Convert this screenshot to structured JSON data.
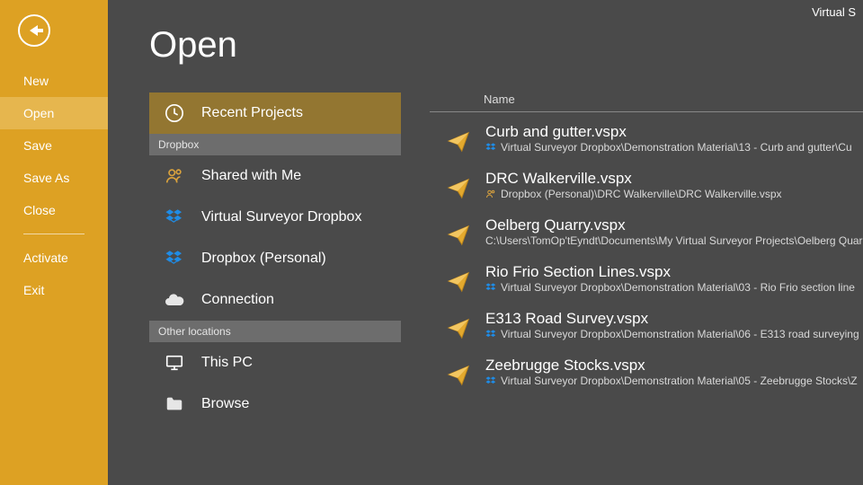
{
  "titlebar": "Virtual S",
  "sidebar": {
    "items": [
      {
        "label": "New",
        "selected": false
      },
      {
        "label": "Open",
        "selected": true
      },
      {
        "label": "Save",
        "selected": false
      },
      {
        "label": "Save As",
        "selected": false
      },
      {
        "label": "Close",
        "selected": false
      }
    ],
    "lower": [
      {
        "label": "Activate"
      },
      {
        "label": "Exit"
      }
    ]
  },
  "page": {
    "title": "Open"
  },
  "places": {
    "top": {
      "label": "Recent Projects",
      "icon": "clock-icon",
      "selected": true
    },
    "groups": [
      {
        "header": "Dropbox",
        "items": [
          {
            "label": "Shared with Me",
            "icon": "people-icon"
          },
          {
            "label": "Virtual Surveyor Dropbox",
            "icon": "dropbox-icon"
          },
          {
            "label": "Dropbox (Personal)",
            "icon": "dropbox-icon"
          },
          {
            "label": "Connection",
            "icon": "cloud-icon"
          }
        ]
      },
      {
        "header": "Other locations",
        "items": [
          {
            "label": "This PC",
            "icon": "monitor-icon"
          },
          {
            "label": "Browse",
            "icon": "folder-icon"
          }
        ]
      }
    ]
  },
  "grid": {
    "columns": {
      "name": "Name"
    },
    "rows": [
      {
        "name": "Curb and gutter.vspx",
        "pathicon": "dropbox-icon",
        "path": "Virtual Surveyor Dropbox\\Demonstration Material\\13 - Curb and gutter\\Cu"
      },
      {
        "name": "DRC Walkerville.vspx",
        "pathicon": "people-icon",
        "path": "Dropbox (Personal)\\DRC Walkerville\\DRC Walkerville.vspx"
      },
      {
        "name": "Oelberg Quarry.vspx",
        "pathicon": "",
        "path": "C:\\Users\\TomOp'tEyndt\\Documents\\My Virtual Surveyor Projects\\Oelberg Quar"
      },
      {
        "name": "Rio Frio Section Lines.vspx",
        "pathicon": "dropbox-icon",
        "path": "Virtual Surveyor Dropbox\\Demonstration Material\\03 - Rio Frio section line"
      },
      {
        "name": "E313 Road Survey.vspx",
        "pathicon": "dropbox-icon",
        "path": "Virtual Surveyor Dropbox\\Demonstration Material\\06 - E313 road surveying"
      },
      {
        "name": "Zeebrugge Stocks.vspx",
        "pathicon": "dropbox-icon",
        "path": "Virtual Surveyor Dropbox\\Demonstration Material\\05 - Zeebrugge Stocks\\Z"
      }
    ]
  },
  "colors": {
    "accent": "#dda123",
    "selected_place": "#937631",
    "dropbox_blue": "#1f8ce6",
    "people_gold": "#d9a23d",
    "paperplane": "#e3a92e"
  }
}
